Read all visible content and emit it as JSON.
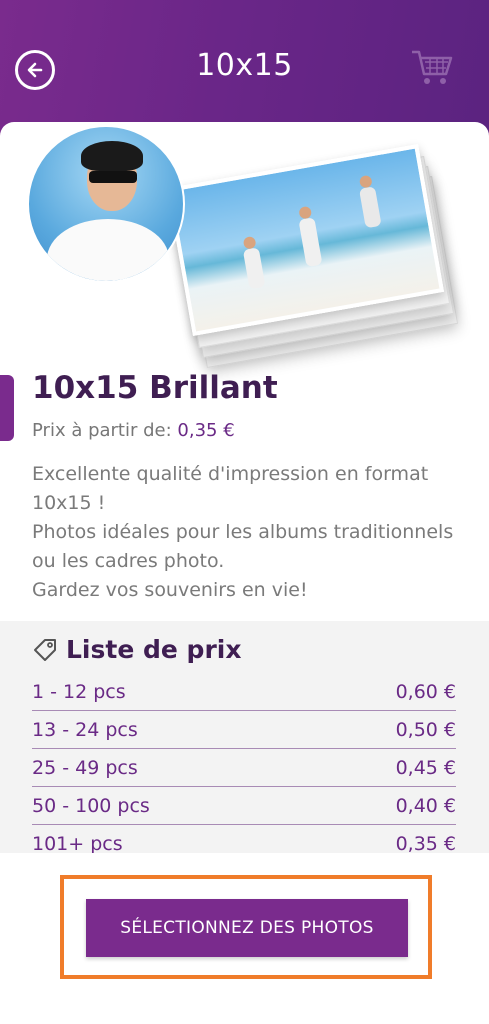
{
  "header": {
    "title": "10x15",
    "back_icon": "back-arrow-circle-icon",
    "cart_icon": "shopping-cart-icon"
  },
  "product": {
    "name": "10x15 Brillant",
    "price_prefix": "Prix à partir de:",
    "price_value": "0,35 €",
    "description_lines": [
      "Excellente qualité d'impression en format 10x15 !",
      "Photos idéales pour les albums traditionnels ou les cadres photo.",
      "Gardez vos souvenirs en vie!"
    ]
  },
  "price_list": {
    "title": "Liste de prix",
    "icon": "price-tag-icon",
    "rows": [
      {
        "range": "1 - 12 pcs",
        "price": "0,60 €"
      },
      {
        "range": "13 - 24 pcs",
        "price": "0,50 €"
      },
      {
        "range": "25 - 49 pcs",
        "price": "0,45 €"
      },
      {
        "range": "50 - 100 pcs",
        "price": "0,40 €"
      },
      {
        "range": "101+ pcs",
        "price": "0,35 €"
      }
    ]
  },
  "cta": {
    "label": "SÉLECTIONNEZ DES PHOTOS"
  },
  "colors": {
    "brand_purple": "#7a2b8d",
    "title_dark": "#3f1e52",
    "highlight_orange": "#f07c2a"
  }
}
